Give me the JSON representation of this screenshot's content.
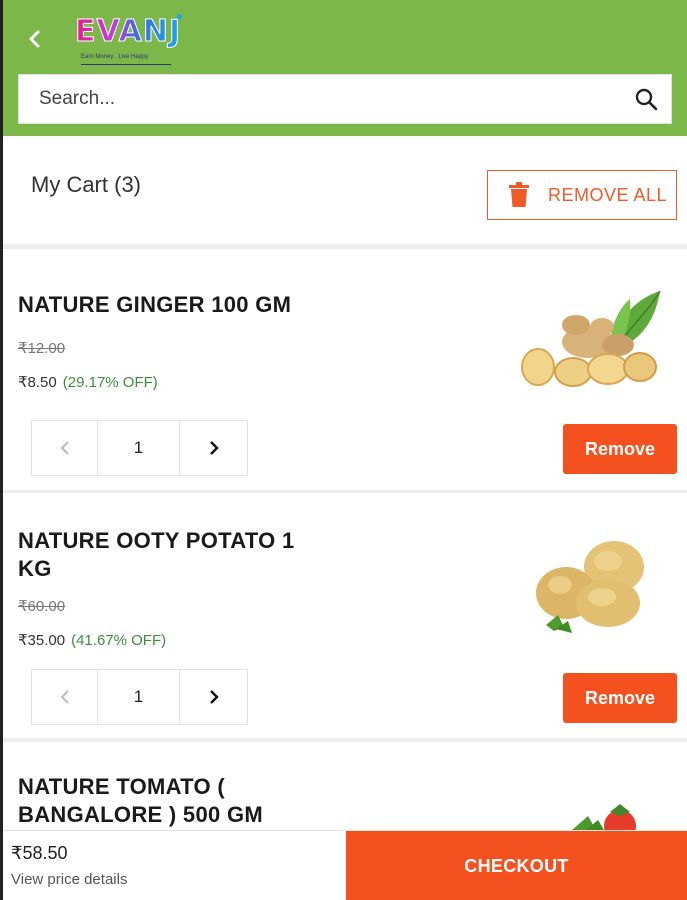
{
  "header": {
    "back_icon": "chevron-left-icon",
    "logo_text": "EVANJ",
    "logo_tagline": "Earn Money . Live Happy"
  },
  "search": {
    "placeholder": "Search...",
    "value": "",
    "icon": "search-icon"
  },
  "cart": {
    "title": "My Cart (3)",
    "remove_all_label": "REMOVE ALL",
    "remove_all_icon": "trash-icon"
  },
  "items": [
    {
      "name": "NATURE GINGER 100 GM",
      "mrp": "₹12.00",
      "price": "₹8.50",
      "discount": "(29.17% OFF)",
      "quantity": "1",
      "remove_label": "Remove",
      "image": "ginger-image"
    },
    {
      "name": "NATURE OOTY POTATO 1 KG",
      "mrp": "₹60.00",
      "price": "₹35.00",
      "discount": "(41.67% OFF)",
      "quantity": "1",
      "remove_label": "Remove",
      "image": "potato-image"
    },
    {
      "name": "NATURE TOMATO ( BANGALORE ) 500 GM",
      "image": "tomato-image"
    }
  ],
  "footer": {
    "total": "₹58.50",
    "price_details_label": "View price details",
    "checkout_label": "CHECKOUT"
  },
  "colors": {
    "header_green": "#7cb74a",
    "accent_orange": "#f4511e",
    "discount_green": "#3d8c40"
  }
}
